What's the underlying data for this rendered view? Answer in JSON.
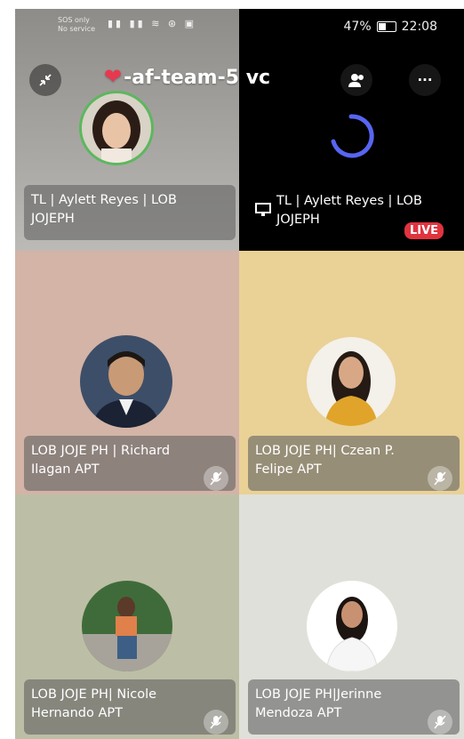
{
  "status_bar": {
    "sim_line1": "SOS only",
    "sim_line2": "No service",
    "icons": "▮▮ ▮▮ ≋ ⊛ ▣",
    "battery_percent": "47%",
    "battery_level": 0.47,
    "time": "22:08"
  },
  "header": {
    "title": "-af-team-5 vc",
    "title_emoji": "❤",
    "collapse_icon": "collapse-arrows-icon",
    "members_icon": "people-icon",
    "more_icon": "more-dots-icon",
    "more_glyph": "···"
  },
  "tiles": [
    {
      "name": "TL | Aylett Reyes | LOB JOJEPH",
      "line1": "TL | Aylett Reyes | LOB",
      "line2": "JOJEPH",
      "speaking": true,
      "bg": "#a09e9a"
    },
    {
      "name": "TL | Aylett Reyes | LOB JOJEPH",
      "line1": "TL | Aylett Reyes | LOB",
      "line2": "JOJEPH",
      "badge": "LIVE",
      "screen_share": true,
      "bg": "#000000"
    },
    {
      "line1": "LOB JOJE PH | Richard",
      "line2": "Ilagan APT",
      "muted": true,
      "bg": "#d3b4a6"
    },
    {
      "line1": "LOB JOJE PH| Czean P.",
      "line2": "Felipe APT",
      "muted": true,
      "bg": "#ead196"
    },
    {
      "line1": "LOB JOJE PH| Nicole",
      "line2": "Hernando APT",
      "muted": true,
      "bg": "#bdbea6"
    },
    {
      "line1": "LOB JOJE PH|Jerinne",
      "line2": "Mendoza APT",
      "muted": true,
      "bg": "#e0e0da"
    }
  ],
  "colors": {
    "live_badge": "#e0343f",
    "speaking_ring": "#5bb85d",
    "spinner": "#5865f2"
  }
}
